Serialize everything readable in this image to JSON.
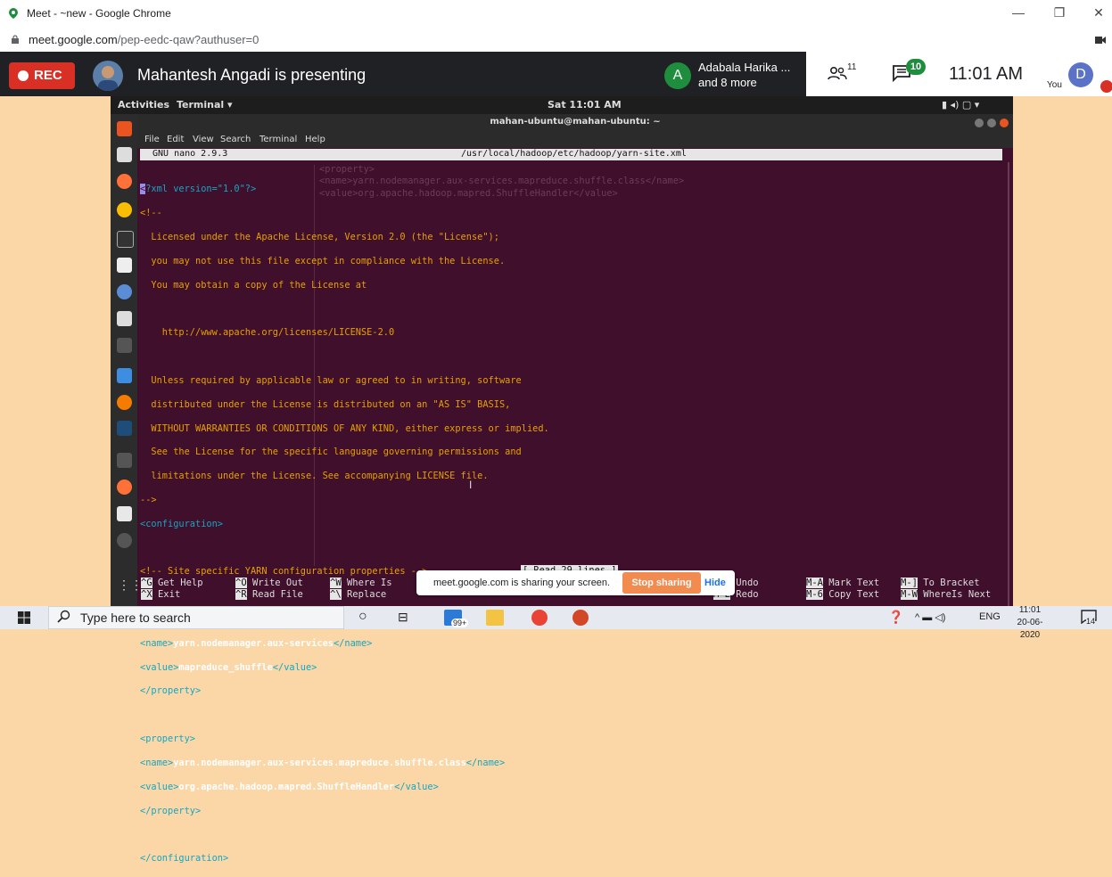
{
  "browser": {
    "title": "Meet - ~new - Google Chrome",
    "url_host": "meet.google.com",
    "url_path": "/pep-eedc-qaw?authuser=0"
  },
  "meet": {
    "rec_label": "REC",
    "presenting_text": "Mahantesh Angadi is presenting",
    "participant_initial": "A",
    "participant_name": "Adabala Harika ...",
    "participant_more": "and 8 more",
    "people_count": "11",
    "chat_count": "10",
    "time": "11:01 AM",
    "you_label": "You",
    "user_initial": "D",
    "share_notice": "meet.google.com is sharing your screen.",
    "stop_sharing_label": "Stop sharing",
    "hide_label": "Hide"
  },
  "ubuntu": {
    "activities": "Activities",
    "app_menu": "Terminal ▾",
    "clock": "Sat 11:01 AM",
    "window_title": "mahan-ubuntu@mahan-ubuntu: ~",
    "menu": [
      "File",
      "Edit",
      "View",
      "Search",
      "Terminal",
      "Help"
    ]
  },
  "nano": {
    "version": "GNU nano 2.9.3",
    "file_path": "/usr/local/hadoop/etc/hadoop/yarn-site.xml",
    "status_msg": "[ Read 29 lines ]",
    "shortcuts_row1": [
      {
        "key": "^G",
        "label": "Get Help"
      },
      {
        "key": "^O",
        "label": "Write Out"
      },
      {
        "key": "^W",
        "label": "Where Is"
      },
      {
        "key": "M-U",
        "label": "Undo"
      },
      {
        "key": "M-A",
        "label": "Mark Text"
      },
      {
        "key": "M-]",
        "label": "To Bracket"
      }
    ],
    "shortcuts_row2": [
      {
        "key": "^X",
        "label": "Exit"
      },
      {
        "key": "^R",
        "label": "Read File"
      },
      {
        "key": "^\\",
        "label": "Replace"
      },
      {
        "key": "M-E",
        "label": "Redo"
      },
      {
        "key": "M-6",
        "label": "Copy Text"
      },
      {
        "key": "M-W",
        "label": "WhereIs Next"
      }
    ]
  },
  "xml": {
    "decl_rest": "?xml version=\"1.0\"?>",
    "c_open": "<!--",
    "lic1": "  Licensed under the Apache License, Version 2.0 (the \"License\");",
    "lic2": "  you may not use this file except in compliance with the License.",
    "lic3": "  You may obtain a copy of the License at",
    "lic4": "    http://www.apache.org/licenses/LICENSE-2.0",
    "lic5": "  Unless required by applicable law or agreed to in writing, software",
    "lic6": "  distributed under the License is distributed on an \"AS IS\" BASIS,",
    "lic7": "  WITHOUT WARRANTIES OR CONDITIONS OF ANY KIND, either express or implied.",
    "lic8": "  See the License for the specific language governing permissions and",
    "lic9": "  limitations under the License. See accompanying LICENSE file.",
    "c_close": "-->",
    "config_open": "<configuration>",
    "site_comment": "<!-- Site specific YARN configuration properties -->",
    "prop_open": "<property>",
    "name_open": "<name>",
    "name_close": "</name>",
    "value_open": "<value>",
    "value_close": "</value>",
    "prop_close": "</property>",
    "config_close": "</configuration>",
    "p1_name": "yarn.nodemanager.aux-services",
    "p1_value": "mapreduce_shuffle",
    "p2_name": "yarn.nodemanager.aux-services.mapreduce.shuffle.class",
    "p2_value": "org.apache.hadoop.mapred.ShuffleHandler"
  },
  "taskbar": {
    "search_placeholder": "Type here to search",
    "mail_badge": "99+",
    "lang": "ENG",
    "time": "11:01",
    "date": "20-06-2020",
    "notif_count": "14"
  }
}
